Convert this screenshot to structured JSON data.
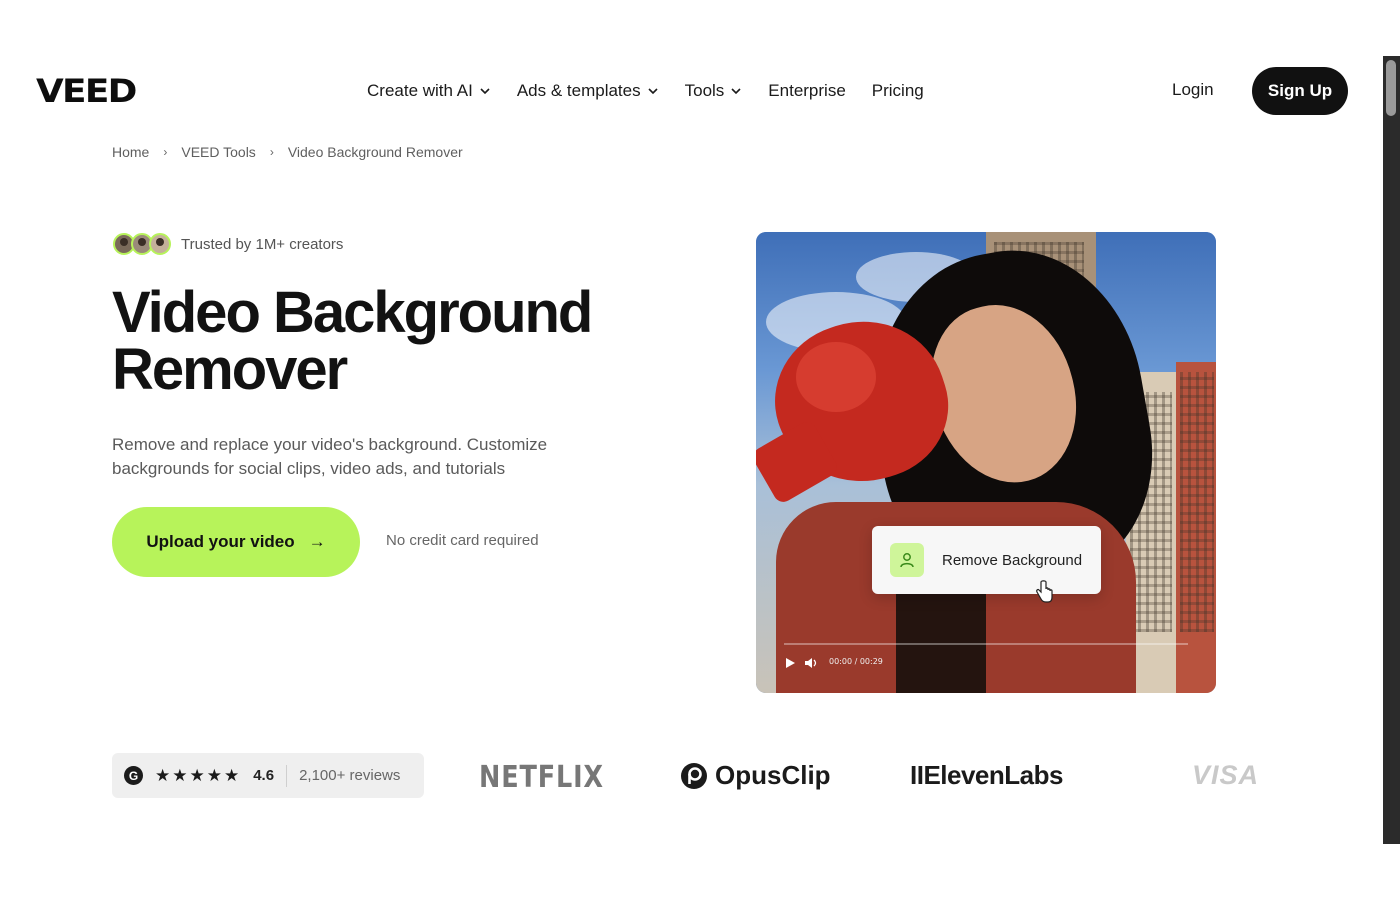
{
  "header": {
    "logo": "VEED",
    "nav": [
      {
        "label": "Create with AI",
        "dropdown": true
      },
      {
        "label": "Ads & templates",
        "dropdown": true
      },
      {
        "label": "Tools",
        "dropdown": true
      },
      {
        "label": "Enterprise",
        "dropdown": false
      },
      {
        "label": "Pricing",
        "dropdown": false
      }
    ],
    "login": "Login",
    "signup": "Sign Up"
  },
  "breadcrumb": [
    "Home",
    "VEED Tools",
    "Video Background Remover"
  ],
  "hero": {
    "trusted": "Trusted by 1M+ creators",
    "title_line1": "Video Background",
    "title_line2": "Remover",
    "subtitle": "Remove and replace your video's background. Customize backgrounds for social clips, video ads, and tutorials",
    "cta": "Upload your video",
    "cta_arrow": "→",
    "note": "No credit card required"
  },
  "media": {
    "chip_label": "Remove Background",
    "timecode": "00:00 / 00:29"
  },
  "trust": {
    "g_icon": "G",
    "stars": "★★★★★",
    "rating": "4.6",
    "reviews": "2,100+ reviews",
    "brands": [
      "NETFLIX",
      "OpusClip",
      "IIElevenLabs",
      "VISA"
    ]
  },
  "colors": {
    "accent": "#b7f35a",
    "dark": "#111111"
  }
}
